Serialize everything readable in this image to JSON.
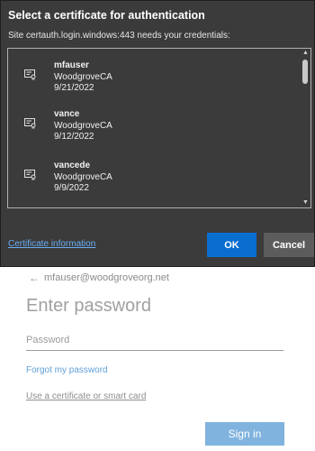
{
  "dialog": {
    "title": "Select a certificate for authentication",
    "subtitle": "Site certauth.login.windows:443 needs your credentials:",
    "certificates": [
      {
        "name": "mfauser",
        "issuer": "WoodgroveCA",
        "date": "9/21/2022"
      },
      {
        "name": "vance",
        "issuer": "WoodgroveCA",
        "date": "9/12/2022"
      },
      {
        "name": "vancede",
        "issuer": "WoodgroveCA",
        "date": "9/9/2022"
      }
    ],
    "cert_info_link": "Certificate information",
    "ok_label": "OK",
    "cancel_label": "Cancel",
    "cert_icon": "certificate-icon"
  },
  "signin": {
    "back_icon": "back-arrow-icon",
    "back_arrow": "←",
    "account": "mfauser@woodgroveorg.net",
    "heading": "Enter password",
    "password_placeholder": "Password",
    "password_value": "",
    "forgot_link": "Forgot my password",
    "cert_link": "Use a certificate or smart card",
    "signin_label": "Sign in"
  },
  "colors": {
    "dialog_bg": "#3b3b3b",
    "ok_blue": "#0a6ed1",
    "cancel_gray": "#5c5c5c",
    "link_blue": "#6aaef2",
    "signin_button": "#80b3de"
  }
}
